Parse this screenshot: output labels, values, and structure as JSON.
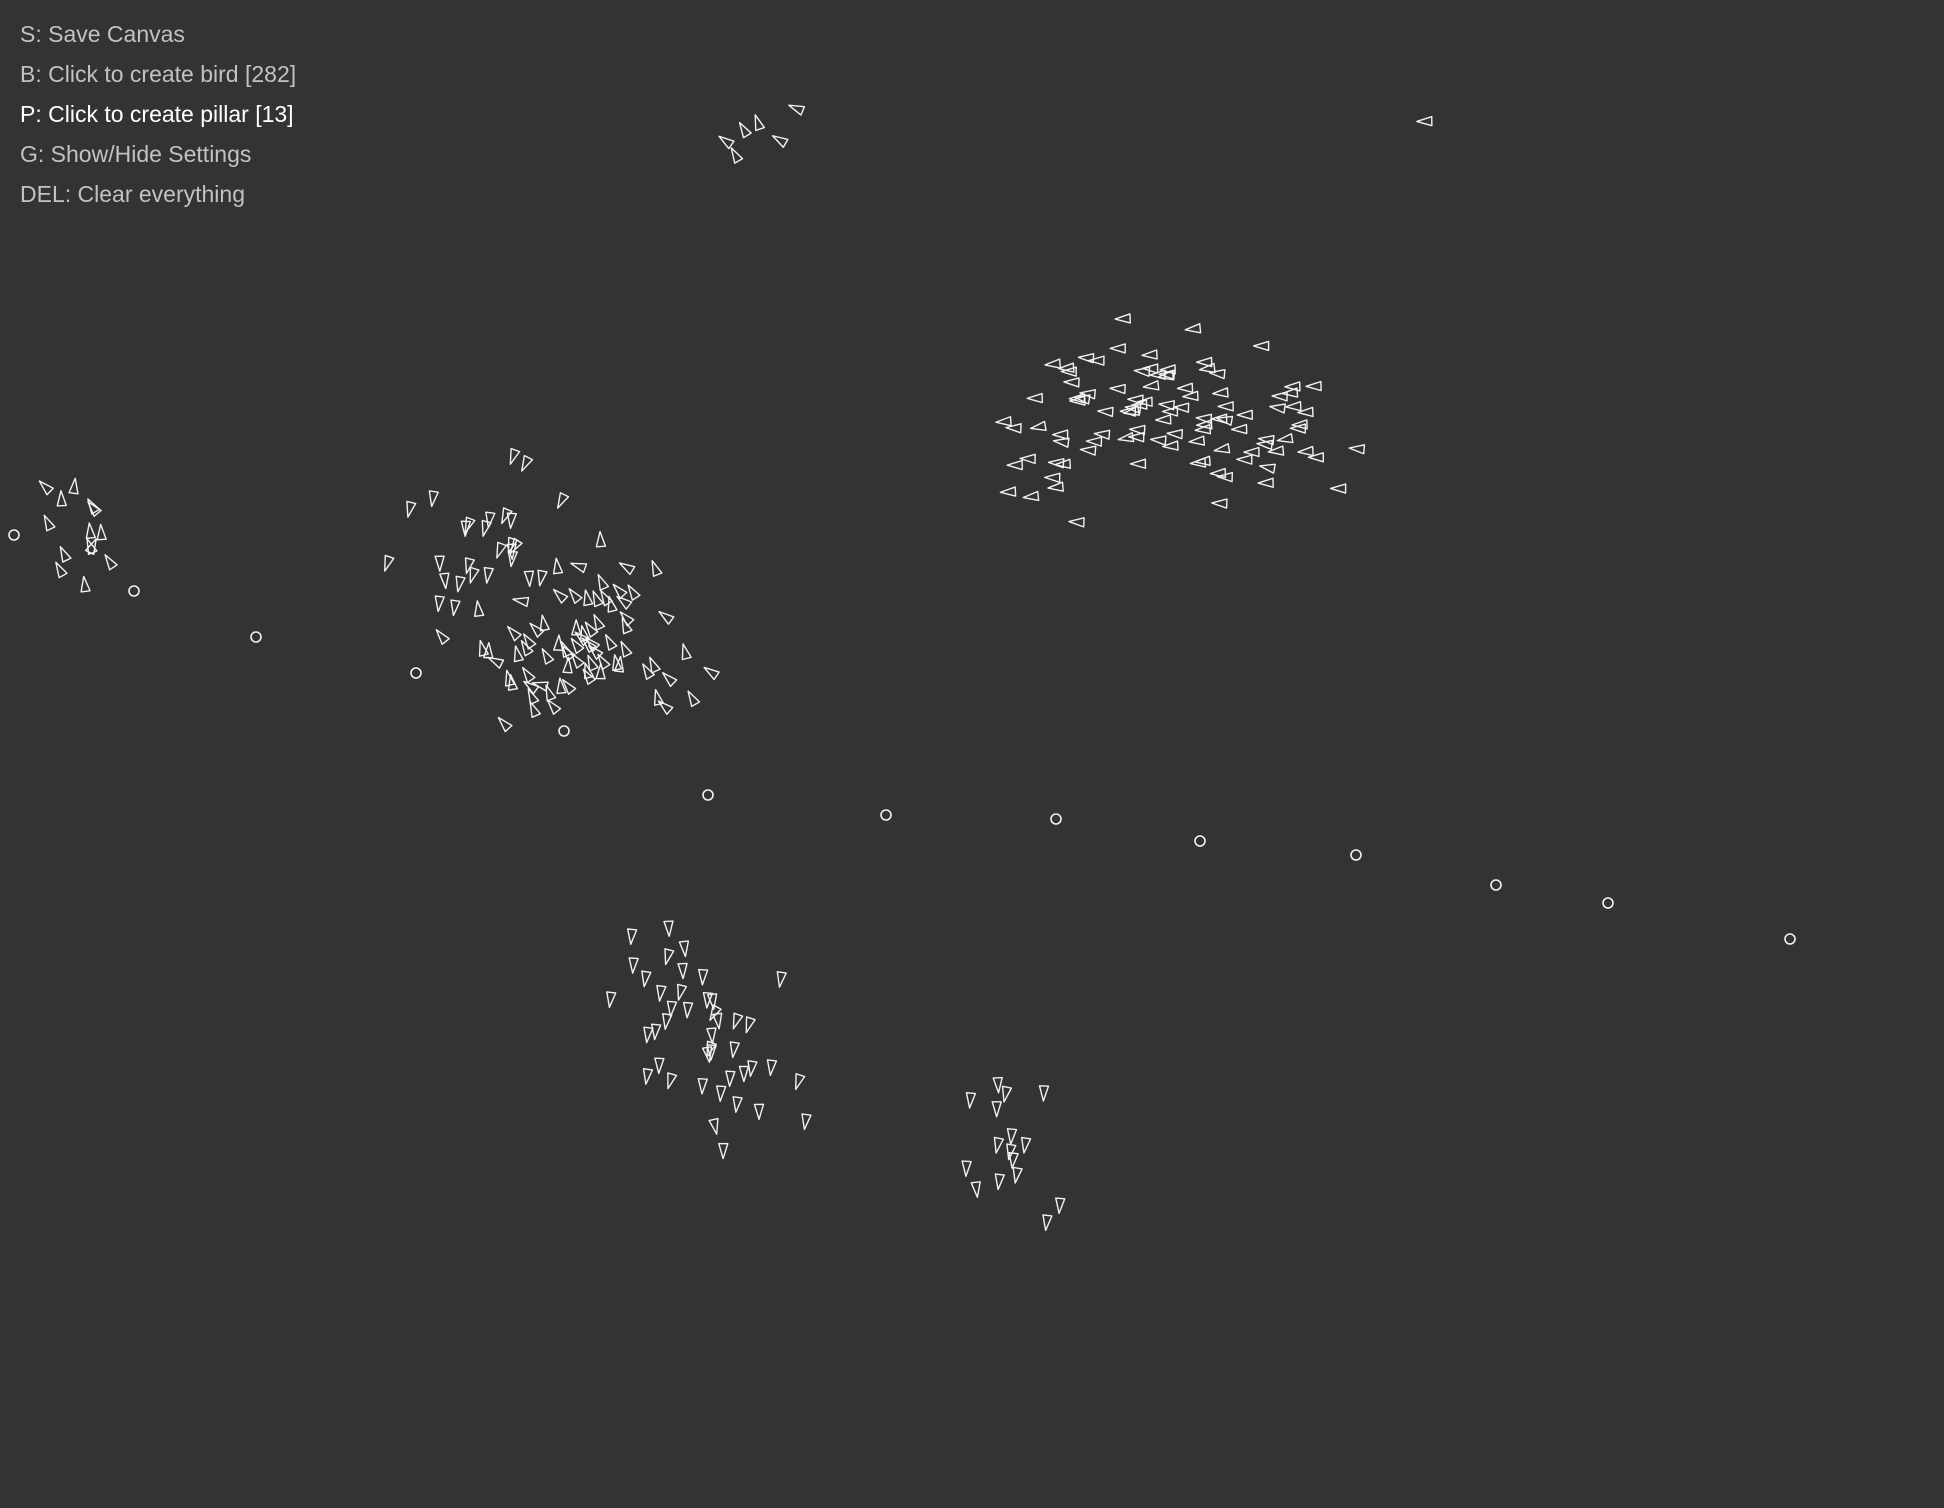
{
  "menu": {
    "items": [
      {
        "key": "S",
        "label": "S: Save Canvas",
        "active": false
      },
      {
        "key": "B",
        "label": "B: Click to create bird [282]",
        "active": false
      },
      {
        "key": "P",
        "label": "P: Click to create pillar [13]",
        "active": true
      },
      {
        "key": "G",
        "label": "G: Show/Hide Settings",
        "active": false
      },
      {
        "key": "DEL",
        "label": "DEL: Clear everything",
        "active": false
      }
    ]
  },
  "simulation": {
    "bird_count": 282,
    "pillar_count": 13,
    "background_color": "#333333",
    "stroke_color": "#f2f2f2",
    "menu_text_color": "#c2c2c2",
    "active_menu_color": "#ffffff",
    "bird_icon": "triangle-arrow",
    "pillar_icon": "small-circle"
  }
}
